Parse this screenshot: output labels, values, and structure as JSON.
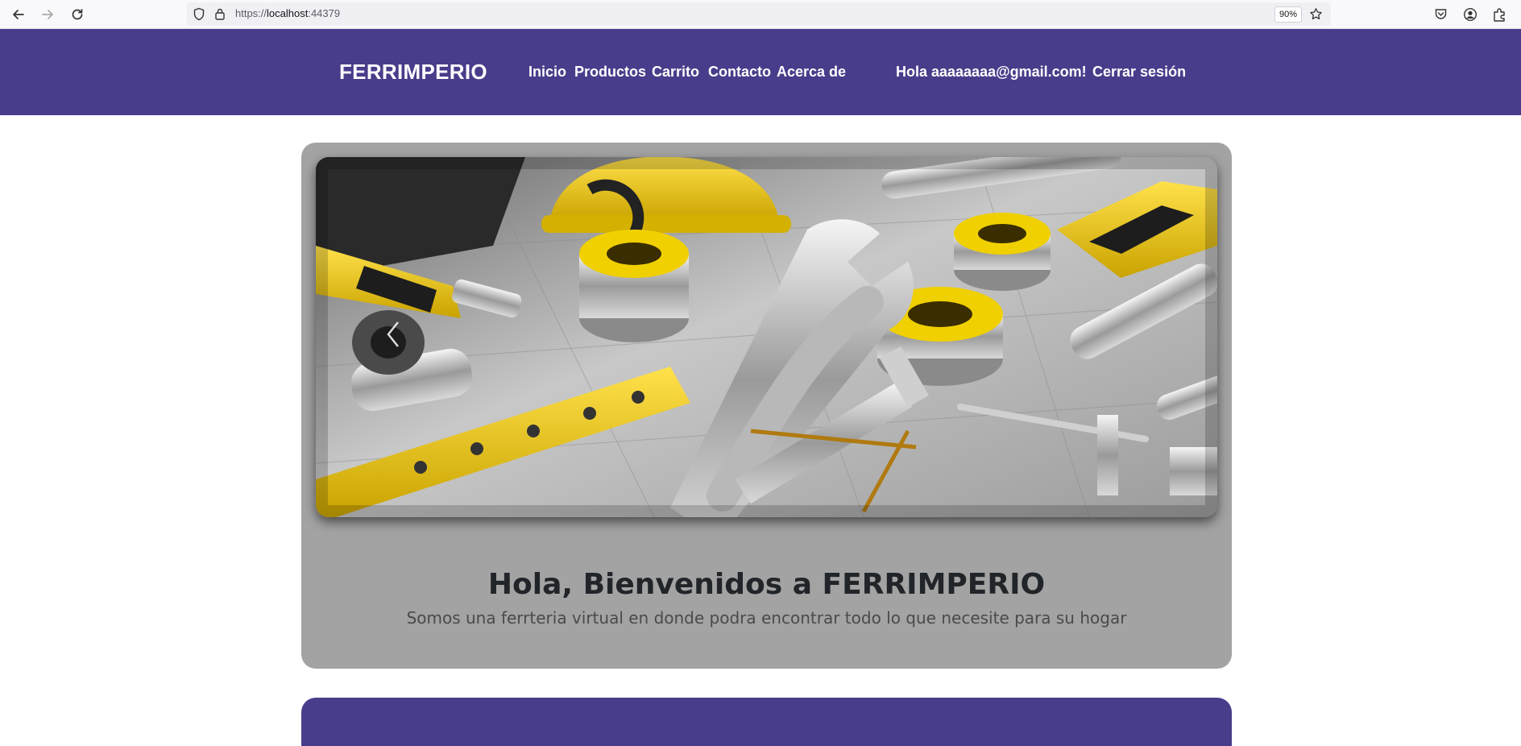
{
  "browser": {
    "url_scheme": "https://",
    "url_host": "localhost",
    "url_port": ":44379",
    "zoom": "90%"
  },
  "site": {
    "brand": "FERRIMPERIO",
    "nav": [
      "Inicio",
      "Productos",
      "Carrito",
      "Contacto",
      "Acerca de"
    ],
    "greeting": "Hola aaaaaaaa@gmail.com!",
    "logout": "Cerrar sesión",
    "header_color": "#483d8b"
  },
  "hero": {
    "title": "Hola, Bienvenidos a FERRIMPERIO",
    "subtitle": "Somos una ferrteria virtual en donde podra encontrar todo lo que necesite para su hogar",
    "image_icon": "hardware-tools-image",
    "card_color": "#a3a3a3"
  }
}
